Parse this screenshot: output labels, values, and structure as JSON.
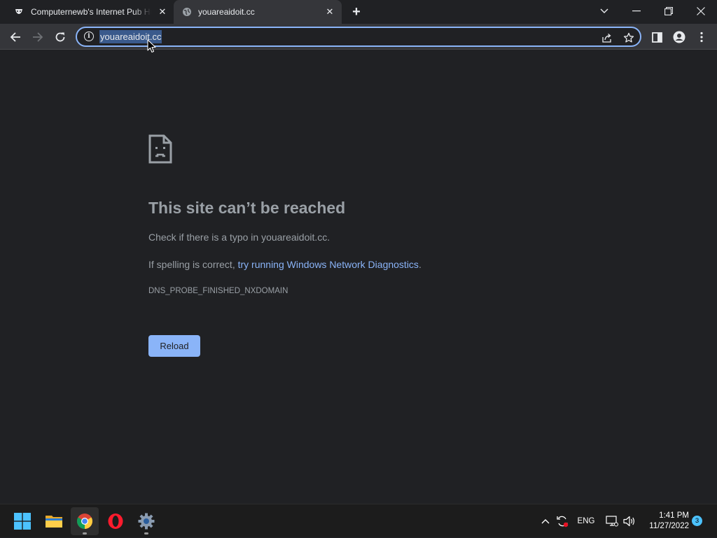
{
  "browser": {
    "tabs": [
      {
        "title": "Computernewb's Internet Pub Hub",
        "favicon": "anonymous-mask-icon",
        "active": false
      },
      {
        "title": "youareaidoit.cc",
        "favicon": "globe-icon",
        "active": true
      }
    ],
    "omnibox": {
      "url": "youareaidoit.cc"
    }
  },
  "error_page": {
    "title": "This site can’t be reached",
    "check_text": "Check if there is a typo in youareaidoit.cc.",
    "spelling_prefix": "If spelling is correct, ",
    "diagnostics_link": "try running Windows Network Diagnostics",
    "spelling_suffix": ".",
    "error_code": "DNS_PROBE_FINISHED_NXDOMAIN",
    "reload_label": "Reload"
  },
  "taskbar": {
    "apps": [
      "windows-start",
      "file-explorer",
      "chrome",
      "opera",
      "settings"
    ],
    "language": "ENG",
    "time": "1:41 PM",
    "date": "11/27/2022",
    "notification_count": "3"
  },
  "colors": {
    "link": "#8ab4f8",
    "button": "#8ab4f8",
    "page_bg": "#202124",
    "toolbar_bg": "#35363a"
  }
}
